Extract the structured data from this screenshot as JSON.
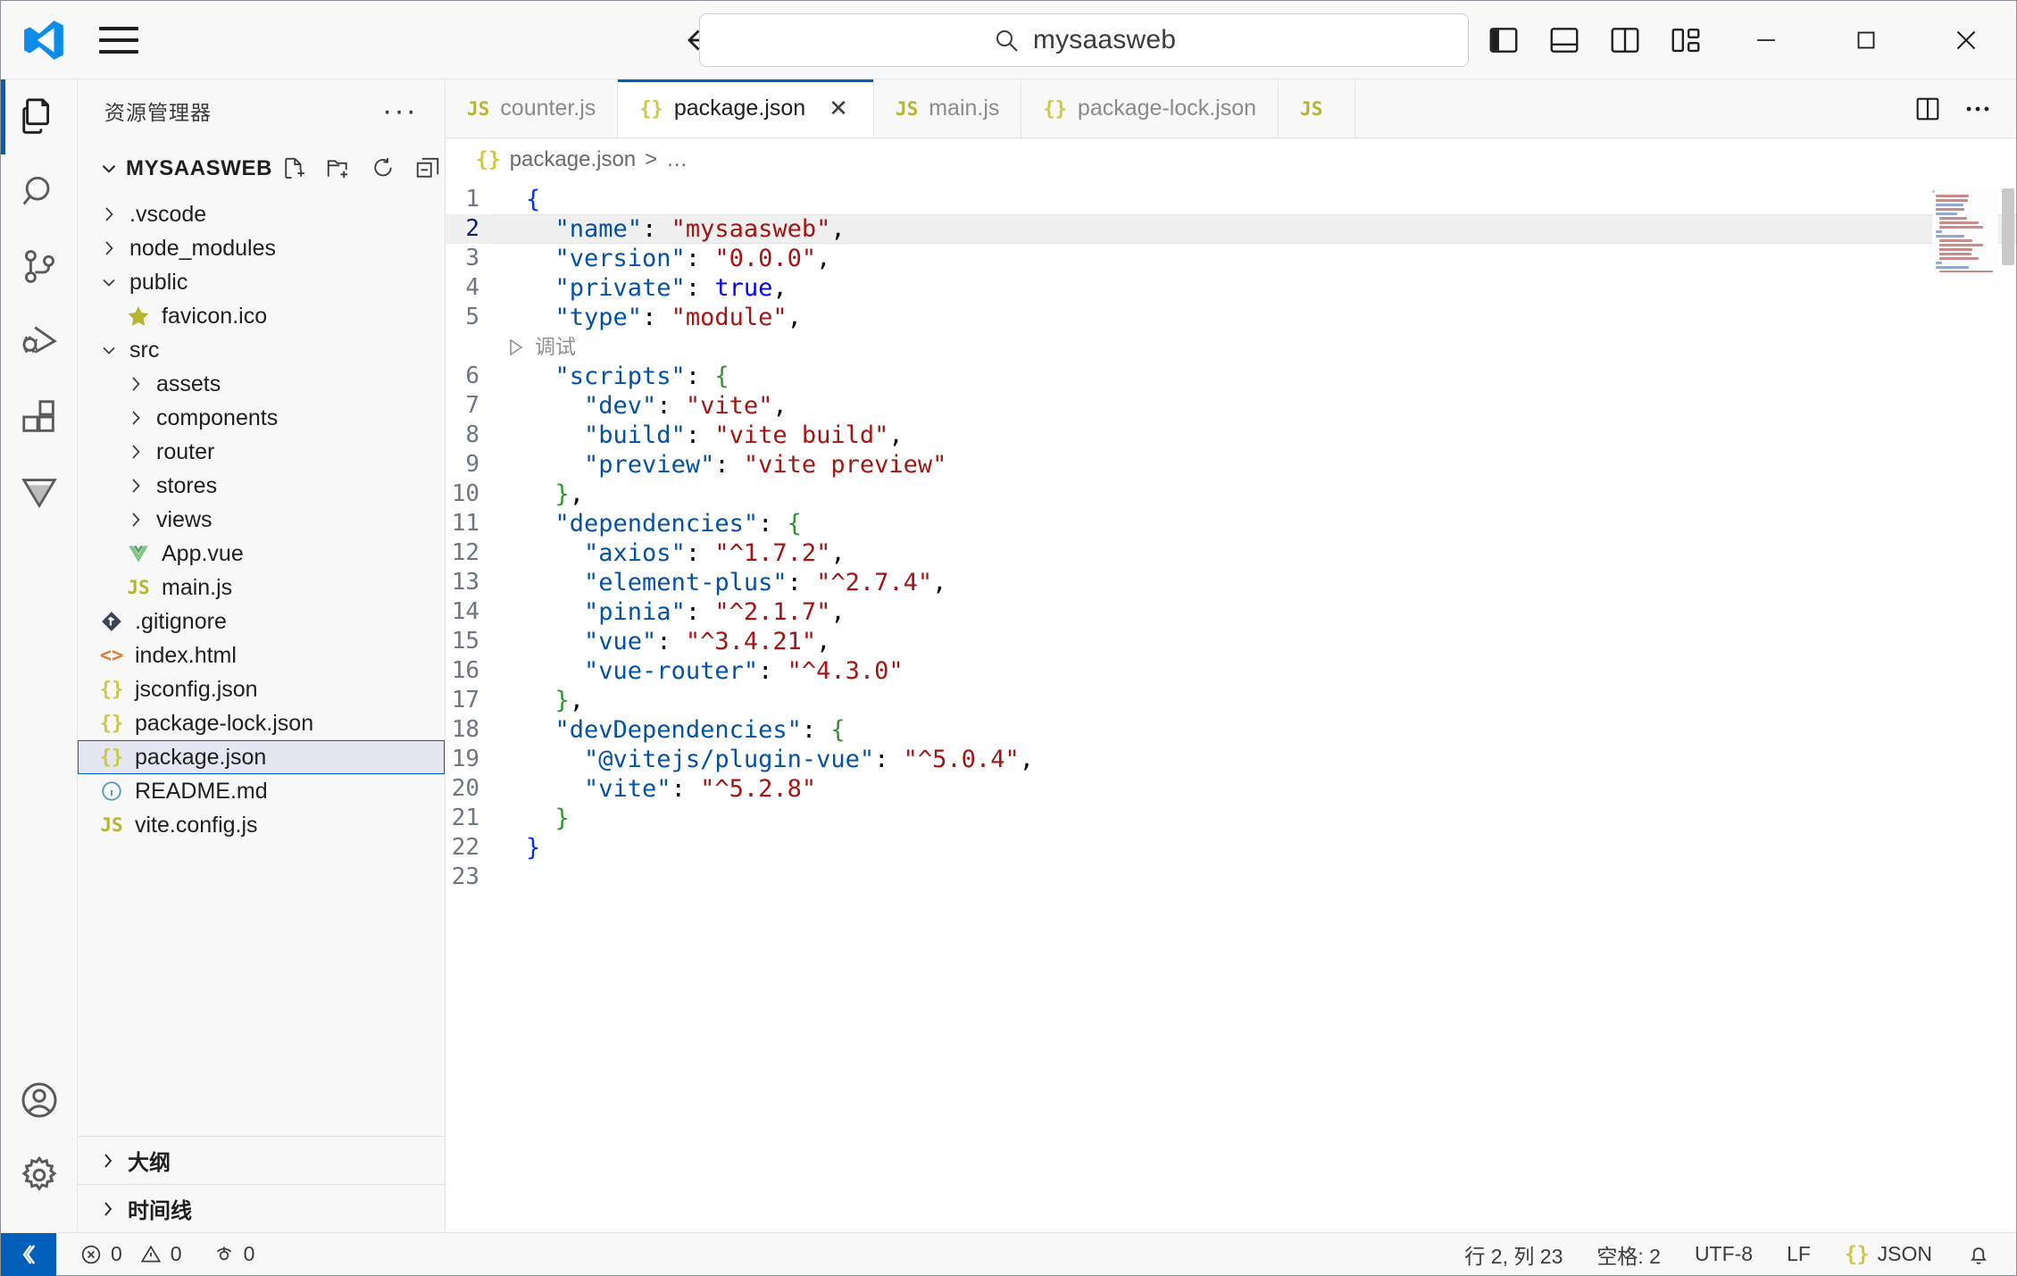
{
  "titlebar": {
    "search_value": "mysaasweb",
    "search_icon": "search-icon",
    "menu_icon": "hamburger-menu-icon",
    "back_icon": "back-arrow-icon",
    "forward_icon": "forward-arrow-icon",
    "layout_buttons": [
      {
        "name": "toggle-primary-sidebar-button",
        "icon": "panel-left-icon"
      },
      {
        "name": "toggle-panel-button",
        "icon": "panel-bottom-icon"
      },
      {
        "name": "toggle-secondary-sidebar-button",
        "icon": "panel-right-icon"
      },
      {
        "name": "customize-layout-button",
        "icon": "layout-grid-icon"
      }
    ],
    "window_buttons": [
      {
        "name": "minimize-button",
        "icon": "minimize-icon"
      },
      {
        "name": "maximize-button",
        "icon": "maximize-icon"
      },
      {
        "name": "close-button",
        "icon": "close-icon"
      }
    ]
  },
  "activitybar": {
    "items": [
      {
        "name": "activity-explorer",
        "icon": "files-icon",
        "active": true
      },
      {
        "name": "activity-search",
        "icon": "search-icon",
        "active": false
      },
      {
        "name": "activity-source-control",
        "icon": "source-control-icon",
        "active": false
      },
      {
        "name": "activity-run-debug",
        "icon": "run-debug-icon",
        "active": false
      },
      {
        "name": "activity-extensions",
        "icon": "extensions-icon",
        "active": false
      },
      {
        "name": "activity-vue-devtools",
        "icon": "vue-funnel-icon",
        "active": false
      }
    ],
    "bottom": [
      {
        "name": "activity-accounts",
        "icon": "account-icon"
      },
      {
        "name": "activity-settings",
        "icon": "gear-icon"
      }
    ]
  },
  "sidebar": {
    "title": "资源管理器",
    "more_actions": "···",
    "root_label": "MYSAASWEB",
    "head_actions": [
      {
        "name": "new-file-button",
        "icon": "new-file-icon"
      },
      {
        "name": "new-folder-button",
        "icon": "new-folder-icon"
      },
      {
        "name": "refresh-explorer-button",
        "icon": "refresh-icon"
      },
      {
        "name": "collapse-folders-button",
        "icon": "collapse-all-icon"
      }
    ],
    "tree": [
      {
        "label": ".vscode",
        "type": "folder",
        "expanded": false,
        "indent": 1
      },
      {
        "label": "node_modules",
        "type": "folder",
        "expanded": false,
        "indent": 1
      },
      {
        "label": "public",
        "type": "folder",
        "expanded": true,
        "indent": 1
      },
      {
        "label": "favicon.ico",
        "type": "file",
        "icon": "star",
        "indent": 2
      },
      {
        "label": "src",
        "type": "folder",
        "expanded": true,
        "indent": 1
      },
      {
        "label": "assets",
        "type": "folder",
        "expanded": false,
        "indent": 2
      },
      {
        "label": "components",
        "type": "folder",
        "expanded": false,
        "indent": 2
      },
      {
        "label": "router",
        "type": "folder",
        "expanded": false,
        "indent": 2
      },
      {
        "label": "stores",
        "type": "folder",
        "expanded": false,
        "indent": 2
      },
      {
        "label": "views",
        "type": "folder",
        "expanded": false,
        "indent": 2
      },
      {
        "label": "App.vue",
        "type": "file",
        "icon": "vue",
        "indent": 2
      },
      {
        "label": "main.js",
        "type": "file",
        "icon": "js",
        "indent": 2
      },
      {
        "label": ".gitignore",
        "type": "file",
        "icon": "git",
        "indent": 1
      },
      {
        "label": "index.html",
        "type": "file",
        "icon": "html",
        "indent": 1
      },
      {
        "label": "jsconfig.json",
        "type": "file",
        "icon": "json",
        "indent": 1
      },
      {
        "label": "package-lock.json",
        "type": "file",
        "icon": "json",
        "indent": 1
      },
      {
        "label": "package.json",
        "type": "file",
        "icon": "json",
        "indent": 1,
        "selected": true
      },
      {
        "label": "README.md",
        "type": "file",
        "icon": "info",
        "indent": 1
      },
      {
        "label": "vite.config.js",
        "type": "file",
        "icon": "js",
        "indent": 1
      }
    ],
    "sections": [
      {
        "label": "大纲",
        "name": "outline-section"
      },
      {
        "label": "时间线",
        "name": "timeline-section"
      }
    ]
  },
  "editor": {
    "tabs": [
      {
        "label": "counter.js",
        "icon": "js",
        "active": false,
        "closeable": false
      },
      {
        "label": "package.json",
        "icon": "json",
        "active": true,
        "closeable": true,
        "close_label": "✕"
      },
      {
        "label": "main.js",
        "icon": "js",
        "active": false,
        "closeable": false
      },
      {
        "label": "package-lock.json",
        "icon": "json",
        "active": false,
        "closeable": false
      },
      {
        "label": "",
        "icon": "js",
        "active": false,
        "closeable": false
      }
    ],
    "tab_actions": [
      {
        "name": "split-editor-right-button",
        "icon": "split-editor-icon"
      },
      {
        "name": "editor-more-actions-button",
        "icon": "ellipsis-icon"
      }
    ],
    "breadcrumb": {
      "file": "package.json",
      "separator": ">",
      "tail": "…",
      "icon": "json"
    },
    "codelens": {
      "label": "调试",
      "icon": "play-icon",
      "line_after": 5
    },
    "current_line": 2,
    "lines": [
      {
        "n": 1,
        "guides": 0,
        "tokens": [
          {
            "t": "{",
            "c": "br1"
          }
        ]
      },
      {
        "n": 2,
        "guides": 1,
        "tokens": [
          {
            "t": "  ",
            "c": "p"
          },
          {
            "t": "\"name\"",
            "c": "k"
          },
          {
            "t": ": ",
            "c": "p"
          },
          {
            "t": "\"mysaasweb\"",
            "c": "s"
          },
          {
            "t": ",",
            "c": "p"
          }
        ]
      },
      {
        "n": 3,
        "guides": 1,
        "tokens": [
          {
            "t": "  ",
            "c": "p"
          },
          {
            "t": "\"version\"",
            "c": "k"
          },
          {
            "t": ": ",
            "c": "p"
          },
          {
            "t": "\"0.0.0\"",
            "c": "s"
          },
          {
            "t": ",",
            "c": "p"
          }
        ]
      },
      {
        "n": 4,
        "guides": 1,
        "tokens": [
          {
            "t": "  ",
            "c": "p"
          },
          {
            "t": "\"private\"",
            "c": "k"
          },
          {
            "t": ": ",
            "c": "p"
          },
          {
            "t": "true",
            "c": "b"
          },
          {
            "t": ",",
            "c": "p"
          }
        ]
      },
      {
        "n": 5,
        "guides": 1,
        "tokens": [
          {
            "t": "  ",
            "c": "p"
          },
          {
            "t": "\"type\"",
            "c": "k"
          },
          {
            "t": ": ",
            "c": "p"
          },
          {
            "t": "\"module\"",
            "c": "s"
          },
          {
            "t": ",",
            "c": "p"
          }
        ]
      },
      {
        "n": 6,
        "guides": 1,
        "tokens": [
          {
            "t": "  ",
            "c": "p"
          },
          {
            "t": "\"scripts\"",
            "c": "k"
          },
          {
            "t": ": ",
            "c": "p"
          },
          {
            "t": "{",
            "c": "br2"
          }
        ]
      },
      {
        "n": 7,
        "guides": 2,
        "tokens": [
          {
            "t": "    ",
            "c": "p"
          },
          {
            "t": "\"dev\"",
            "c": "k"
          },
          {
            "t": ": ",
            "c": "p"
          },
          {
            "t": "\"vite\"",
            "c": "s"
          },
          {
            "t": ",",
            "c": "p"
          }
        ]
      },
      {
        "n": 8,
        "guides": 2,
        "tokens": [
          {
            "t": "    ",
            "c": "p"
          },
          {
            "t": "\"build\"",
            "c": "k"
          },
          {
            "t": ": ",
            "c": "p"
          },
          {
            "t": "\"vite build\"",
            "c": "s"
          },
          {
            "t": ",",
            "c": "p"
          }
        ]
      },
      {
        "n": 9,
        "guides": 2,
        "tokens": [
          {
            "t": "    ",
            "c": "p"
          },
          {
            "t": "\"preview\"",
            "c": "k"
          },
          {
            "t": ": ",
            "c": "p"
          },
          {
            "t": "\"vite preview\"",
            "c": "s"
          }
        ]
      },
      {
        "n": 10,
        "guides": 1,
        "tokens": [
          {
            "t": "  ",
            "c": "p"
          },
          {
            "t": "}",
            "c": "br2"
          },
          {
            "t": ",",
            "c": "p"
          }
        ]
      },
      {
        "n": 11,
        "guides": 1,
        "tokens": [
          {
            "t": "  ",
            "c": "p"
          },
          {
            "t": "\"dependencies\"",
            "c": "k"
          },
          {
            "t": ": ",
            "c": "p"
          },
          {
            "t": "{",
            "c": "br2"
          }
        ]
      },
      {
        "n": 12,
        "guides": 2,
        "tokens": [
          {
            "t": "    ",
            "c": "p"
          },
          {
            "t": "\"axios\"",
            "c": "k"
          },
          {
            "t": ": ",
            "c": "p"
          },
          {
            "t": "\"^1.7.2\"",
            "c": "s"
          },
          {
            "t": ",",
            "c": "p"
          }
        ]
      },
      {
        "n": 13,
        "guides": 2,
        "tokens": [
          {
            "t": "    ",
            "c": "p"
          },
          {
            "t": "\"element-plus\"",
            "c": "k"
          },
          {
            "t": ": ",
            "c": "p"
          },
          {
            "t": "\"^2.7.4\"",
            "c": "s"
          },
          {
            "t": ",",
            "c": "p"
          }
        ]
      },
      {
        "n": 14,
        "guides": 2,
        "tokens": [
          {
            "t": "    ",
            "c": "p"
          },
          {
            "t": "\"pinia\"",
            "c": "k"
          },
          {
            "t": ": ",
            "c": "p"
          },
          {
            "t": "\"^2.1.7\"",
            "c": "s"
          },
          {
            "t": ",",
            "c": "p"
          }
        ]
      },
      {
        "n": 15,
        "guides": 2,
        "tokens": [
          {
            "t": "    ",
            "c": "p"
          },
          {
            "t": "\"vue\"",
            "c": "k"
          },
          {
            "t": ": ",
            "c": "p"
          },
          {
            "t": "\"^3.4.21\"",
            "c": "s"
          },
          {
            "t": ",",
            "c": "p"
          }
        ]
      },
      {
        "n": 16,
        "guides": 2,
        "tokens": [
          {
            "t": "    ",
            "c": "p"
          },
          {
            "t": "\"vue-router\"",
            "c": "k"
          },
          {
            "t": ": ",
            "c": "p"
          },
          {
            "t": "\"^4.3.0\"",
            "c": "s"
          }
        ]
      },
      {
        "n": 17,
        "guides": 1,
        "tokens": [
          {
            "t": "  ",
            "c": "p"
          },
          {
            "t": "}",
            "c": "br2"
          },
          {
            "t": ",",
            "c": "p"
          }
        ]
      },
      {
        "n": 18,
        "guides": 1,
        "tokens": [
          {
            "t": "  ",
            "c": "p"
          },
          {
            "t": "\"devDependencies\"",
            "c": "k"
          },
          {
            "t": ": ",
            "c": "p"
          },
          {
            "t": "{",
            "c": "br2"
          }
        ]
      },
      {
        "n": 19,
        "guides": 2,
        "tokens": [
          {
            "t": "    ",
            "c": "p"
          },
          {
            "t": "\"@vitejs/plugin-vue\"",
            "c": "k"
          },
          {
            "t": ": ",
            "c": "p"
          },
          {
            "t": "\"^5.0.4\"",
            "c": "s"
          },
          {
            "t": ",",
            "c": "p"
          }
        ]
      },
      {
        "n": 20,
        "guides": 2,
        "tokens": [
          {
            "t": "    ",
            "c": "p"
          },
          {
            "t": "\"vite\"",
            "c": "k"
          },
          {
            "t": ": ",
            "c": "p"
          },
          {
            "t": "\"^5.2.8\"",
            "c": "s"
          }
        ]
      },
      {
        "n": 21,
        "guides": 1,
        "tokens": [
          {
            "t": "  ",
            "c": "p"
          },
          {
            "t": "}",
            "c": "br2"
          }
        ]
      },
      {
        "n": 22,
        "guides": 0,
        "tokens": [
          {
            "t": "}",
            "c": "br1"
          }
        ]
      },
      {
        "n": 23,
        "guides": 0,
        "tokens": []
      }
    ]
  },
  "statusbar": {
    "remote_icon": "remote-window-icon",
    "errors": "0",
    "warnings": "0",
    "ports": "0",
    "cursor_position": "行 2, 列 23",
    "indentation": "空格: 2",
    "encoding": "UTF-8",
    "eol": "LF",
    "language": "JSON",
    "language_icon": "json",
    "notifications_icon": "bell-icon"
  },
  "colors": {
    "accent": "#005fb8",
    "json_icon": "#cbcb41",
    "js_icon": "#cbcb41",
    "vue_icon": "#81c784",
    "html_icon": "#e37933",
    "info_icon": "#519aba",
    "string": "#a31515",
    "key": "#0451a5",
    "boolean": "#0000ff"
  }
}
